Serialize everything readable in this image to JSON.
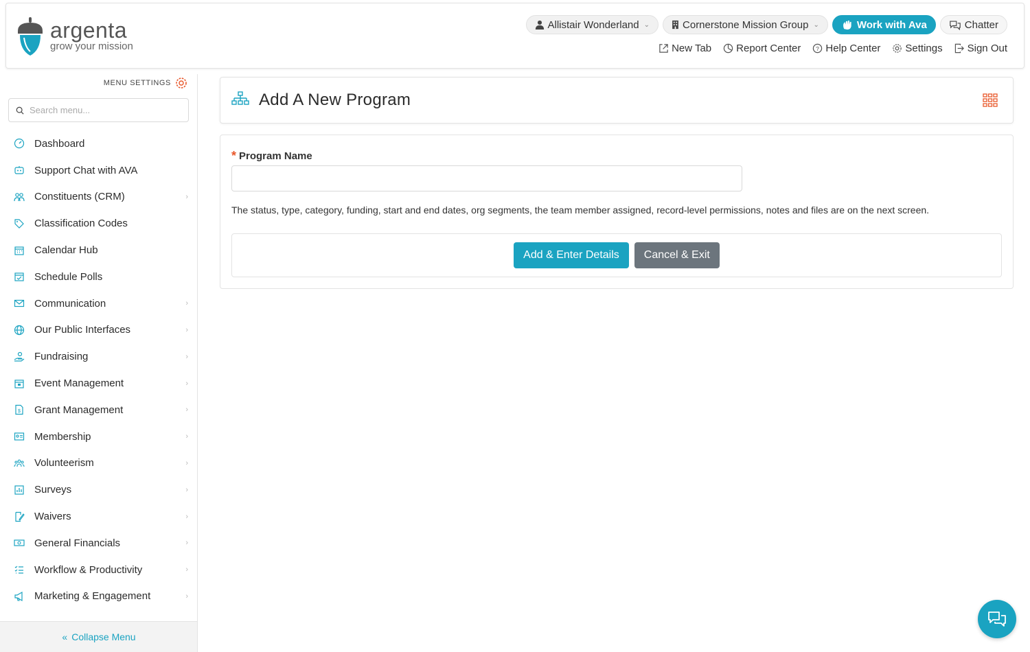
{
  "header": {
    "logo_name": "argenta",
    "logo_tagline": "grow your mission",
    "user_menu": "Allistair Wonderland",
    "org_menu": "Cornerstone Mission Group",
    "ava_button": "Work with Ava",
    "chatter_button": "Chatter",
    "links": {
      "new_tab": "New Tab",
      "report_center": "Report Center",
      "help_center": "Help Center",
      "settings": "Settings",
      "sign_out": "Sign Out"
    }
  },
  "sidebar": {
    "menu_settings_label": "MENU SETTINGS",
    "search_placeholder": "Search menu...",
    "items": [
      {
        "label": "Dashboard",
        "icon": "dashboard-icon",
        "has_children": false
      },
      {
        "label": "Support Chat with AVA",
        "icon": "robot-icon",
        "has_children": false
      },
      {
        "label": "Constituents (CRM)",
        "icon": "people-icon",
        "has_children": true
      },
      {
        "label": "Classification Codes",
        "icon": "tag-icon",
        "has_children": false
      },
      {
        "label": "Calendar Hub",
        "icon": "calendar-icon",
        "has_children": false
      },
      {
        "label": "Schedule Polls",
        "icon": "calendar-check-icon",
        "has_children": false
      },
      {
        "label": "Communication",
        "icon": "envelope-icon",
        "has_children": true
      },
      {
        "label": "Our Public Interfaces",
        "icon": "globe-icon",
        "has_children": true
      },
      {
        "label": "Fundraising",
        "icon": "hand-coin-icon",
        "has_children": true
      },
      {
        "label": "Event Management",
        "icon": "calendar-event-icon",
        "has_children": true
      },
      {
        "label": "Grant Management",
        "icon": "document-dollar-icon",
        "has_children": true
      },
      {
        "label": "Membership",
        "icon": "id-card-icon",
        "has_children": true
      },
      {
        "label": "Volunteerism",
        "icon": "group-icon",
        "has_children": true
      },
      {
        "label": "Surveys",
        "icon": "bar-chart-icon",
        "has_children": true
      },
      {
        "label": "Waivers",
        "icon": "signature-icon",
        "has_children": true
      },
      {
        "label": "General Financials",
        "icon": "cash-icon",
        "has_children": true
      },
      {
        "label": "Workflow & Productivity",
        "icon": "checklist-icon",
        "has_children": true
      },
      {
        "label": "Marketing & Engagement",
        "icon": "megaphone-icon",
        "has_children": true
      }
    ],
    "collapse_label": "Collapse Menu"
  },
  "main": {
    "page_title": "Add A New Program",
    "field_label": "Program Name",
    "field_value": "",
    "help_text": "The status, type, category, funding, start and end dates, org segments, the team member assigned, record-level permissions, notes and files are on the next screen.",
    "primary_button": "Add & Enter Details",
    "secondary_button": "Cancel & Exit"
  },
  "colors": {
    "accent": "#1aa3c1",
    "required": "#e8572a",
    "secondary_button": "#6c757d",
    "grid_icon": "#e8572a"
  }
}
